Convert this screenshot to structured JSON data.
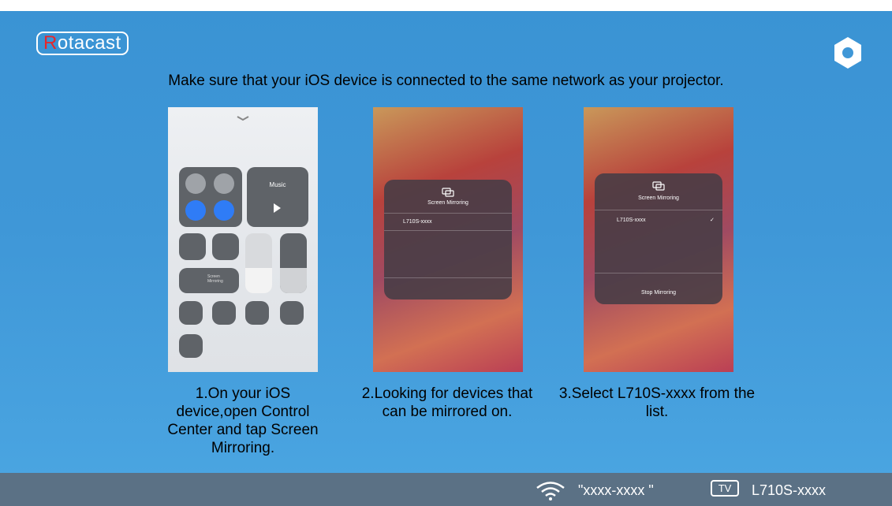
{
  "app": {
    "logo_first": "R",
    "logo_rest": "otacast"
  },
  "instruction": "Make sure that your iOS device is connected to the same network as your projector.",
  "steps": [
    {
      "caption": "1.On your iOS device,open Control Center and tap Screen Mirroring."
    },
    {
      "caption": "2.Looking for devices that can be mirrored on."
    },
    {
      "caption": "3.Select L710S-xxxx from the list."
    }
  ],
  "screenshots": {
    "control_center": {
      "music_label": "Music",
      "screen_mirroring_label_1": "Screen",
      "screen_mirroring_label_2": "Mirroring"
    },
    "mirroring_list": {
      "title": "Screen Mirroring",
      "device": "L710S-xxxx"
    },
    "mirroring_selected": {
      "title": "Screen Mirroring",
      "device": "L710S-xxxx",
      "check": "✓",
      "stop_label": "Stop Mirroring"
    }
  },
  "status": {
    "wifi_name": "\"xxxx-xxxx \"",
    "tv_badge": "TV",
    "device_name": "L710S-xxxx"
  },
  "icons": [
    "settings-icon",
    "wifi-icon",
    "tv-icon"
  ]
}
